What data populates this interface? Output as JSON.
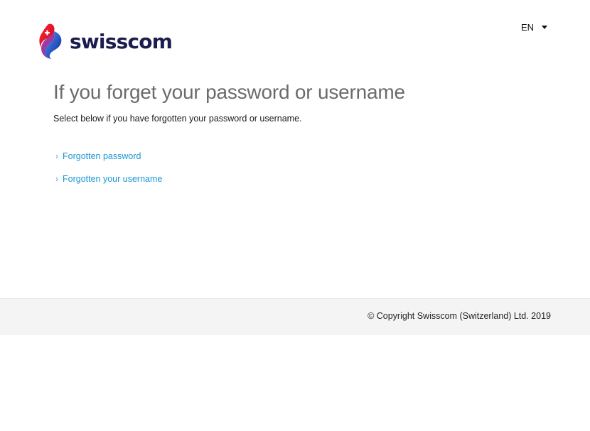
{
  "header": {
    "logo_text": "swisscom",
    "language": "EN"
  },
  "main": {
    "title": "If you forget your password or username",
    "subtitle": "Select below if you have forgotten your password or username.",
    "links": [
      {
        "label": "Forgotten password"
      },
      {
        "label": "Forgotten your username"
      }
    ]
  },
  "footer": {
    "copyright": "© Copyright Swisscom (Switzerland) Ltd. 2019"
  },
  "colors": {
    "link": "#1a96d4",
    "title": "#6b6b6b",
    "brand_navy": "#1b1d4f",
    "brand_red": "#e3000f",
    "footer_bg": "#f4f4f4"
  }
}
